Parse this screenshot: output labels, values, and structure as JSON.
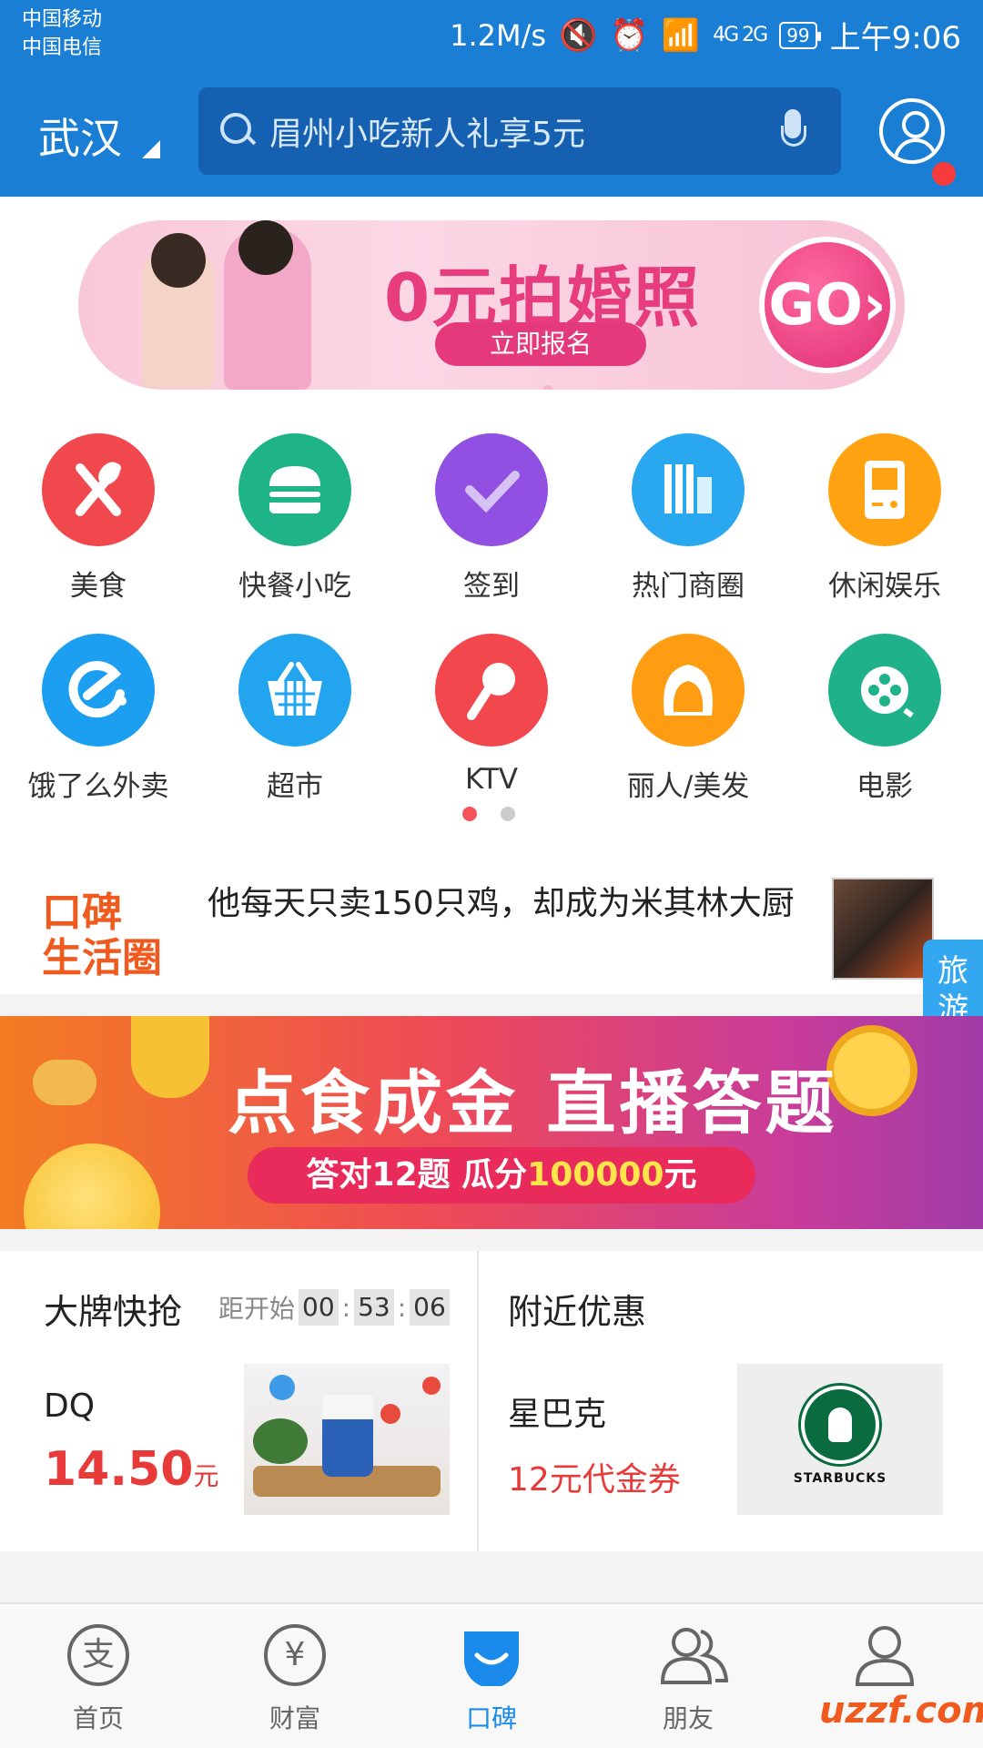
{
  "status_bar": {
    "carrier1": "中国移动",
    "carrier2": "中国电信",
    "speed": "1.2M/s",
    "signal_labels": "4G 2G",
    "battery": "99",
    "time": "上午9:06"
  },
  "header": {
    "city": "武汉",
    "search_placeholder": "眉州小吃新人礼享5元"
  },
  "banner_top": {
    "title": "0元拍婚照",
    "button": "立即报名",
    "go": "GO"
  },
  "grid": {
    "items": [
      {
        "label": "美食",
        "color": "#f1484d",
        "icon": "fork-spoon-icon"
      },
      {
        "label": "快餐小吃",
        "color": "#1fb388",
        "icon": "burger-icon"
      },
      {
        "label": "签到",
        "color": "#9150e2",
        "icon": "check-icon"
      },
      {
        "label": "热门商圈",
        "color": "#29a8f0",
        "icon": "buildings-icon"
      },
      {
        "label": "休闲娱乐",
        "color": "#ffa312",
        "icon": "gameboy-icon"
      },
      {
        "label": "饿了么外卖",
        "color": "#1d9ff1",
        "icon": "eleme-icon"
      },
      {
        "label": "超市",
        "color": "#22a5ee",
        "icon": "basket-icon"
      },
      {
        "label": "KTV",
        "color": "#f2474d",
        "icon": "microphone-icon"
      },
      {
        "label": "丽人/美发",
        "color": "#ff9d12",
        "icon": "woman-icon"
      },
      {
        "label": "电影",
        "color": "#1fb28a",
        "icon": "film-reel-icon"
      }
    ]
  },
  "page_dots": {
    "active": "#f4545a",
    "inactive": "#cccccc"
  },
  "koubei": {
    "logo_line1": "口碑",
    "logo_line2": "生活圈",
    "headline": "他每天只卖150只鸡，却成为米其林大厨"
  },
  "float_tab": {
    "label": "旅游版"
  },
  "banner_quiz": {
    "title": "点食成金 直播答题",
    "sub_prefix": "答对12题  瓜分",
    "sub_amount": "100000",
    "sub_suffix": "元"
  },
  "deals": {
    "left": {
      "title": "大牌快抢",
      "countdown_label": "距开始",
      "hh": "00",
      "mm": "53",
      "ss": "06",
      "brand": "DQ",
      "price": "14.50",
      "unit": "元"
    },
    "right": {
      "title": "附近优惠",
      "brand": "星巴克",
      "offer": "12元代金券",
      "logo_text": "STARBUCKS"
    }
  },
  "bottom_nav": {
    "items": [
      {
        "label": "首页",
        "glyph": "支"
      },
      {
        "label": "财富",
        "glyph": "¥"
      },
      {
        "label": "口碑",
        "glyph": ""
      },
      {
        "label": "朋友",
        "glyph": ""
      },
      {
        "label": "我的",
        "glyph": ""
      }
    ]
  },
  "watermark": {
    "text1": "uzz",
    "text2": "f.com"
  }
}
